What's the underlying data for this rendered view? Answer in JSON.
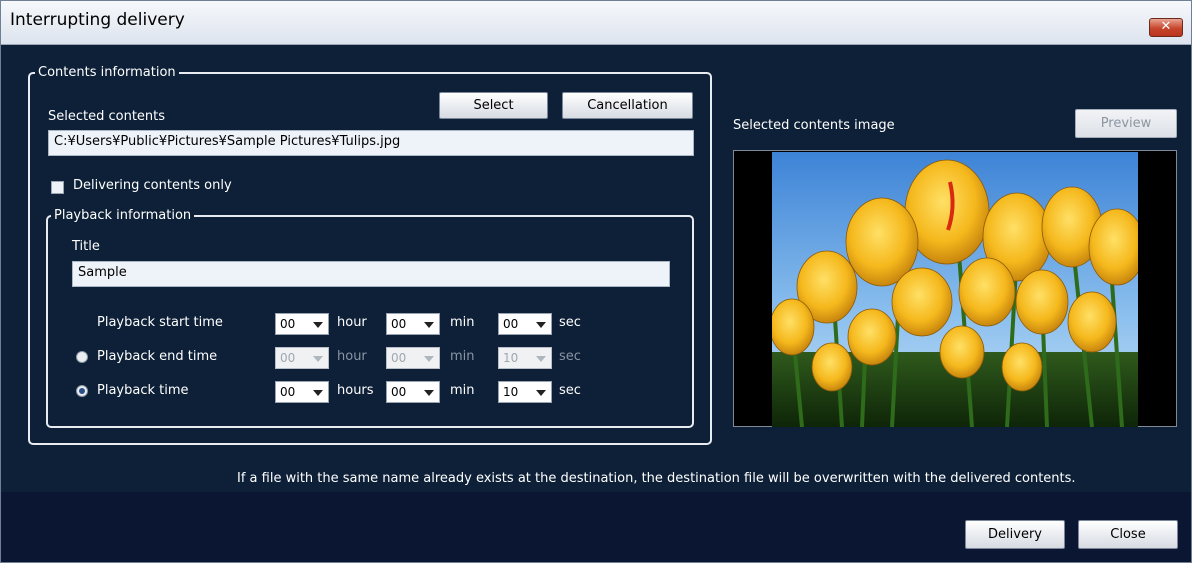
{
  "window": {
    "title": "Interrupting delivery",
    "close_label": "✕"
  },
  "contents_info": {
    "legend": "Contents information",
    "selected_label": "Selected contents",
    "select_button": "Select",
    "cancel_button": "Cancellation",
    "path_value": "C:¥Users¥Public¥Pictures¥Sample Pictures¥Tulips.jpg",
    "delivering_only_label": "Delivering contents only",
    "delivering_only_checked": false
  },
  "playback_info": {
    "legend": "Playback information",
    "title_label": "Title",
    "title_value": "Sample",
    "rows": [
      {
        "label": "Playback start time",
        "radio": "none",
        "h": "00",
        "h_unit": "hour",
        "m": "00",
        "m_unit": "min",
        "s": "00",
        "s_unit": "sec",
        "enabled": true
      },
      {
        "label": "Playback end time",
        "radio": "unchecked",
        "h": "00",
        "h_unit": "hour",
        "m": "00",
        "m_unit": "min",
        "s": "10",
        "s_unit": "sec",
        "enabled": false
      },
      {
        "label": "Playback time",
        "radio": "checked",
        "h": "00",
        "h_unit": "hours",
        "m": "00",
        "m_unit": "min",
        "s": "10",
        "s_unit": "sec",
        "enabled": true
      }
    ]
  },
  "preview": {
    "label": "Selected contents image",
    "button": "Preview"
  },
  "notice": "If a file with the same name already exists at the destination, the destination file will be overwritten with the delivered contents.",
  "footer": {
    "delivery_button": "Delivery",
    "close_button": "Close"
  }
}
